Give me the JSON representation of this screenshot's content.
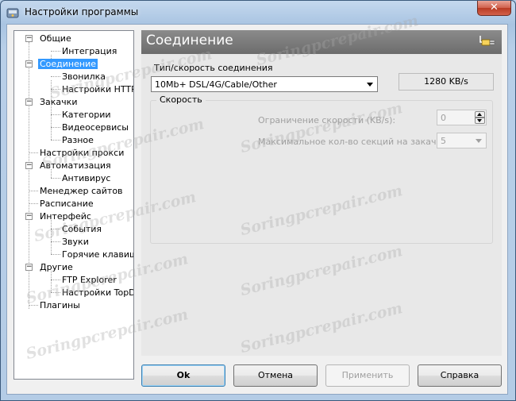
{
  "window": {
    "title": "Настройки программы",
    "close_glyph": "✕"
  },
  "tree": {
    "items": [
      {
        "label": "Общие"
      },
      {
        "label": "Интеграция"
      },
      {
        "label": "Соединение"
      },
      {
        "label": "Звонилка"
      },
      {
        "label": "Настройки HTTP/FTP"
      },
      {
        "label": "Закачки"
      },
      {
        "label": "Категории"
      },
      {
        "label": "Видеосервисы"
      },
      {
        "label": "Разное"
      },
      {
        "label": "Настройки прокси"
      },
      {
        "label": "Автоматизация"
      },
      {
        "label": "Антивирус"
      },
      {
        "label": "Менеджер сайтов"
      },
      {
        "label": "Расписание"
      },
      {
        "label": "Интерфейс"
      },
      {
        "label": "События"
      },
      {
        "label": "Звуки"
      },
      {
        "label": "Горячие клавиши"
      },
      {
        "label": "Другие"
      },
      {
        "label": "FTP Explorer"
      },
      {
        "label": "Настройки TopDownloader"
      },
      {
        "label": "Плагины"
      }
    ],
    "selected": "Соединение",
    "expander_glyph": "−"
  },
  "panel": {
    "title": "Соединение",
    "icon": "plug-icon",
    "connection_type_label": "Тип/скорость соединения",
    "connection_type_value": "10Mb+ DSL/4G/Cable/Other",
    "speed_value": "1280 KB/s",
    "speed_group_title": "Скорость",
    "speed_limit_label": "Ограничение скорости (KB/s):",
    "speed_limit_value": "0",
    "max_sections_label": "Максимальное кол-во секций на закачку:",
    "max_sections_value": "5"
  },
  "buttons": {
    "ok": "Ok",
    "cancel": "Отмена",
    "apply": "Применить",
    "help": "Справка"
  },
  "watermark": "Soringpcrepair.com",
  "colors": {
    "selected": "#3399ff",
    "header": "#7a7a7a",
    "close": "#c7432b"
  }
}
